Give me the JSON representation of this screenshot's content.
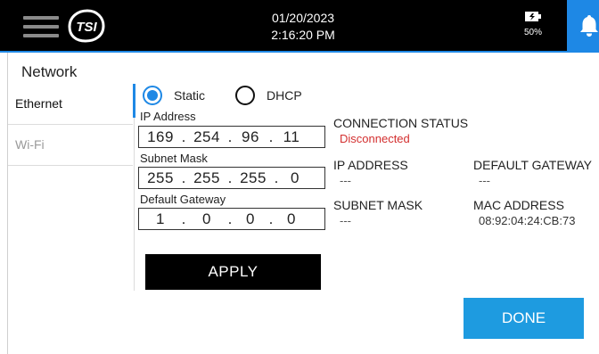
{
  "header": {
    "date": "01/20/2023",
    "time": "2:16:20 PM",
    "battery_percent": "50%",
    "logo_text": "TSI",
    "accent_color": "#1e88e5"
  },
  "page": {
    "title": "Network"
  },
  "sidebar": {
    "items": [
      {
        "label": "Ethernet",
        "active": true
      },
      {
        "label": "Wi-Fi",
        "active": false
      }
    ]
  },
  "mode": {
    "options": [
      {
        "label": "Static",
        "selected": true
      },
      {
        "label": "DHCP",
        "selected": false
      }
    ]
  },
  "form": {
    "ip_address": {
      "label": "IP Address",
      "octets": [
        "169",
        "254",
        "96",
        "11"
      ]
    },
    "subnet_mask": {
      "label": "Subnet Mask",
      "octets": [
        "255",
        "255",
        "255",
        "0"
      ]
    },
    "default_gateway": {
      "label": "Default Gateway",
      "octets": [
        "1",
        "0",
        "0",
        "0"
      ]
    },
    "apply_label": "APPLY"
  },
  "status": {
    "connection_status_label": "CONNECTION STATUS",
    "connection_status_value": "Disconnected",
    "ip_address_label": "IP ADDRESS",
    "ip_address_value": "---",
    "default_gateway_label": "DEFAULT GATEWAY",
    "default_gateway_value": "---",
    "subnet_mask_label": "SUBNET MASK",
    "subnet_mask_value": "---",
    "mac_address_label": "MAC ADDRESS",
    "mac_address_value": "08:92:04:24:CB:73"
  },
  "footer": {
    "done_label": "DONE"
  },
  "colors": {
    "accent": "#1e88e5",
    "error": "#d32f2f",
    "done_button": "#1e9be0"
  }
}
